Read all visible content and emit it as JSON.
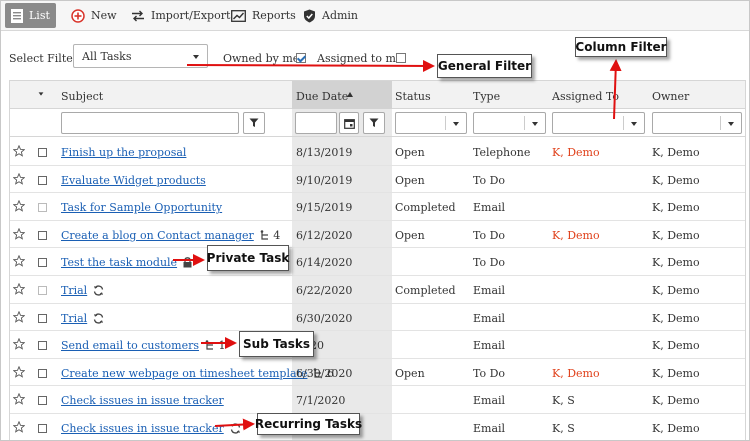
{
  "toolbar": {
    "list": "List",
    "new": "New",
    "import_export": "Import/Export",
    "reports": "Reports",
    "admin": "Admin"
  },
  "filter": {
    "select_label": "Select Filter:",
    "selected": "All Tasks",
    "owned_label": "Owned by me:",
    "owned_checked": true,
    "assigned_label": "Assigned to me:",
    "assigned_checked": false
  },
  "columns": {
    "subject": "Subject",
    "due_date": "Due Date",
    "status": "Status",
    "type": "Type",
    "assigned_to": "Assigned To",
    "owner": "Owner"
  },
  "rows": [
    {
      "subject": "Finish up the proposal",
      "due": "8/13/2019",
      "status": "Open",
      "type": "Telephone",
      "assigned": "K, Demo",
      "owner": "K, Demo"
    },
    {
      "subject": "Evaluate Widget products",
      "due": "9/10/2019",
      "status": "Open",
      "type": "To Do",
      "assigned": "",
      "owner": "K, Demo"
    },
    {
      "subject": "Task for Sample Opportunity",
      "due": "9/15/2019",
      "status": "Completed",
      "type": "Email",
      "assigned": "",
      "owner": "K, Demo"
    },
    {
      "subject": "Create a blog on Contact manager",
      "subtasks": "4",
      "due": "6/12/2020",
      "status": "Open",
      "type": "To Do",
      "assigned": "K, Demo",
      "owner": "K, Demo"
    },
    {
      "subject": "Test the task module",
      "private": true,
      "due": "6/14/2020",
      "status": "",
      "type": "To Do",
      "assigned": "",
      "owner": "K, Demo"
    },
    {
      "subject": "Trial",
      "recurring": true,
      "due": "6/22/2020",
      "status": "Completed",
      "type": "Email",
      "assigned": "",
      "owner": "K, Demo"
    },
    {
      "subject": "Trial",
      "recurring": true,
      "due": "6/30/2020",
      "status": "",
      "type": "Email",
      "assigned": "",
      "owner": "K, Demo"
    },
    {
      "subject": "Send email to customers",
      "subtasks": "1",
      "due": "2020",
      "status": "",
      "type": "Email",
      "assigned": "",
      "owner": "K, Demo"
    },
    {
      "subject": "Create new webpage on timesheet template",
      "subtasks": "6",
      "due": "6/30/2020",
      "status": "Open",
      "type": "To Do",
      "assigned": "K, Demo",
      "owner": "K, Demo"
    },
    {
      "subject": "Check issues in issue tracker",
      "due": "7/1/2020",
      "status": "",
      "type": "Email",
      "assigned": "K, S",
      "owner": "K, Demo"
    },
    {
      "subject": "Check issues in issue tracker",
      "recurring": true,
      "due": "",
      "status": "",
      "type": "Email",
      "assigned": "K, S",
      "owner": "K, Demo"
    }
  ],
  "callouts": {
    "general_filter": "General Filter",
    "column_filter": "Column Filter",
    "private_task": "Private Task",
    "sub_tasks": "Sub Tasks",
    "recurring_tasks": "Recurring Tasks"
  },
  "colors": {
    "link": "#1a5fb4",
    "assigned_red": "#e0401a",
    "arrow_red": "#e01010",
    "toolbar_active": "#8a8a8a",
    "new_icon_red": "#d9342b"
  }
}
